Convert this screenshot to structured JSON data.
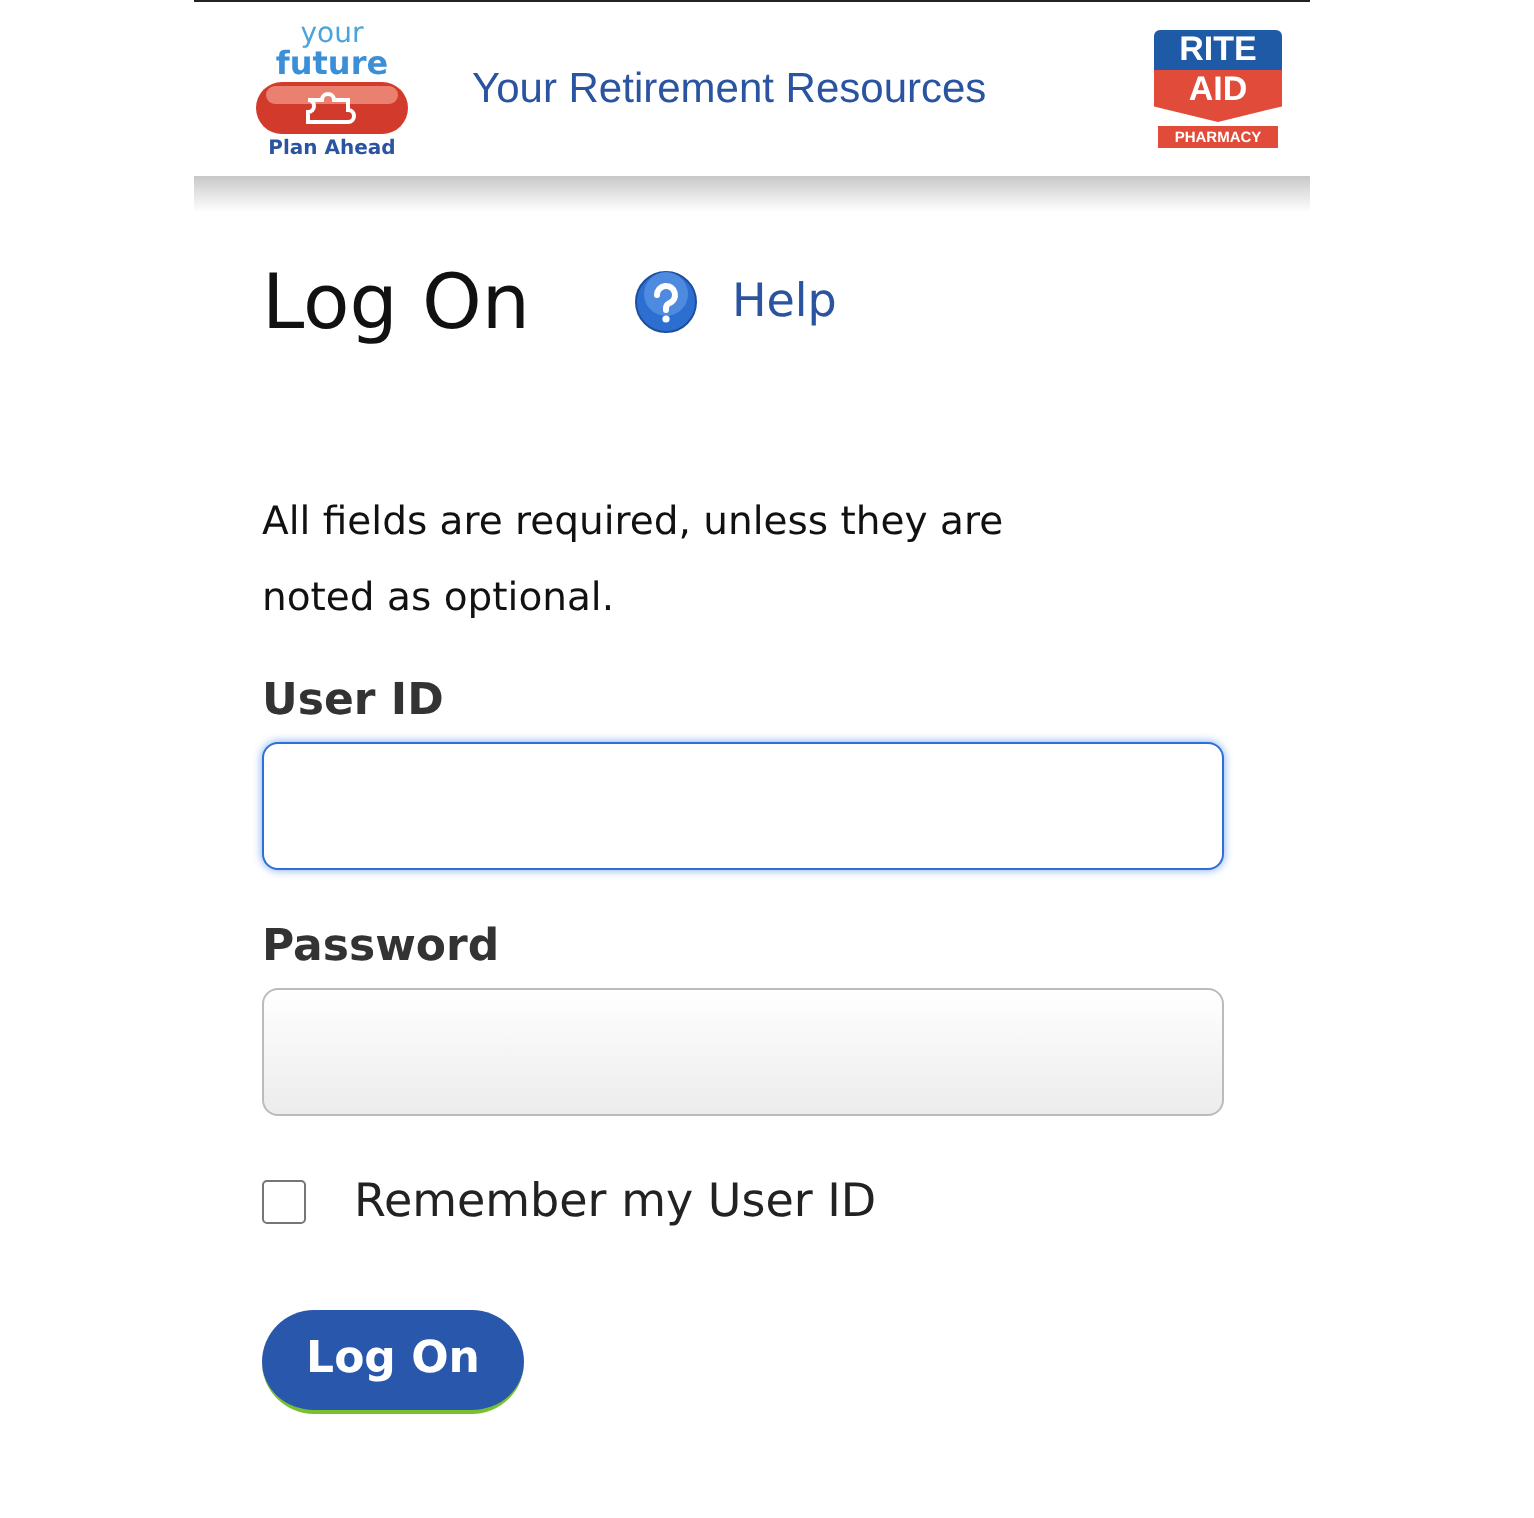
{
  "header": {
    "left_logo": {
      "top_word": "your",
      "bottom_word": "future",
      "caption": "Plan Ahead"
    },
    "title": "Your Retirement Resources",
    "right_logo": {
      "top_word": "RITE",
      "bottom_word": "AID",
      "caption": "PHARMACY"
    }
  },
  "heading": "Log On",
  "help_link": {
    "label": "Help"
  },
  "instructions": "All fields are required, unless they are noted as optional.",
  "fields": [
    {
      "label": "User ID",
      "focused": true
    },
    {
      "label": "Password",
      "focused": false
    }
  ],
  "remember": {
    "label": "Remember my User ID",
    "checked": false
  },
  "submit_button": {
    "label": "Log On"
  }
}
